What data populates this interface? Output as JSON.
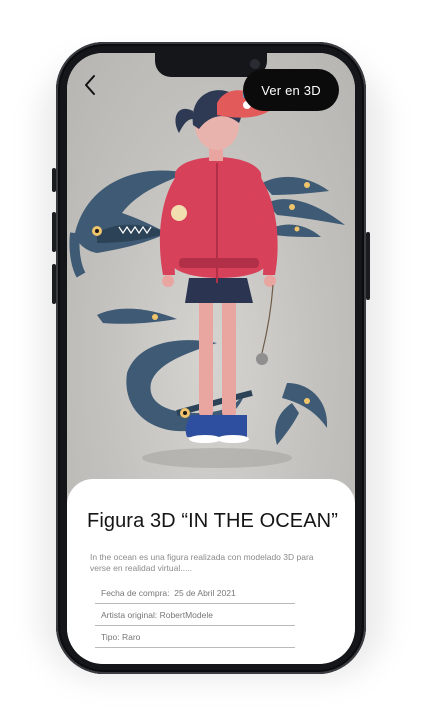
{
  "header": {
    "back_icon": "chevron-left-icon",
    "view_3d_label": "Ver en 3D"
  },
  "product": {
    "title": "Figura 3D “IN THE OCEAN”",
    "description": "In the ocean es una figura realizada con modelado 3D para verse en realidad virtual.....",
    "details": [
      {
        "label": "Fecha de compra:",
        "value": "25 de Abril 2021"
      },
      {
        "label": "Artista original:",
        "value": "RobertModele"
      },
      {
        "label": "Tipo:",
        "value": "Raro"
      }
    ]
  },
  "colors": {
    "button_bg": "#0b0b0b",
    "jacket": "#d8415a",
    "fish": "#3e5a74",
    "hat": "#4fb3e6"
  }
}
